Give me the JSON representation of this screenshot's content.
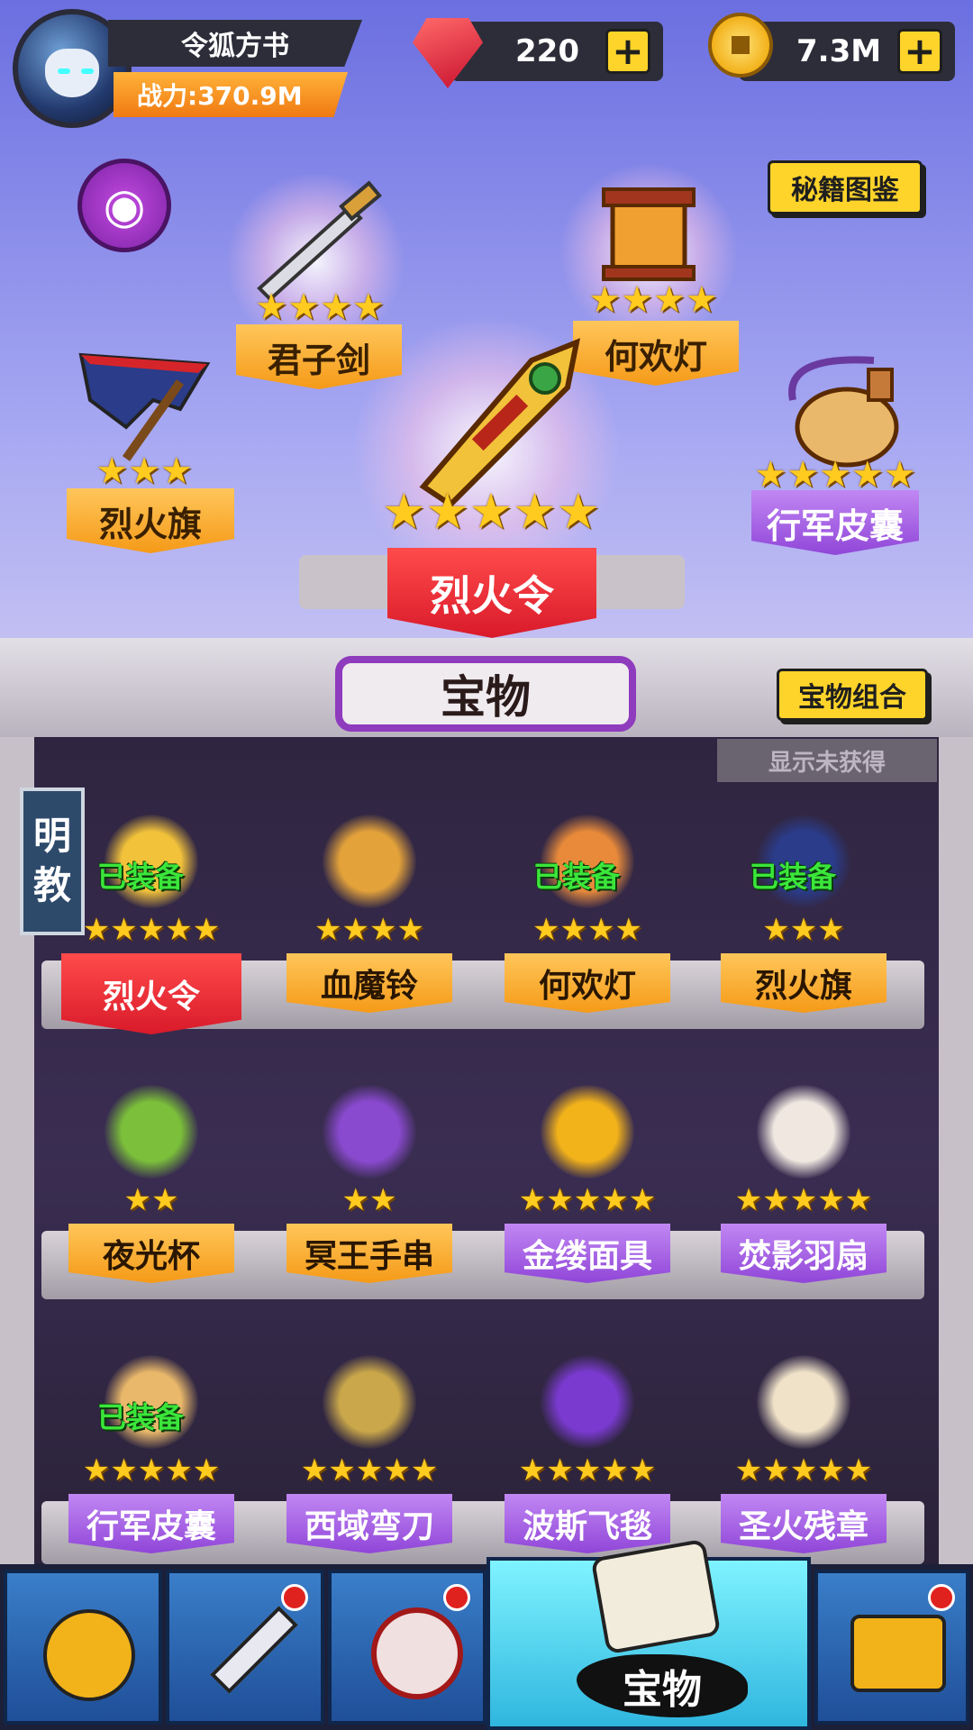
{
  "player": {
    "name": "令狐方书",
    "power": "战力:370.9M"
  },
  "currency": {
    "gems": "220",
    "coins": "7.3M",
    "plus": "+"
  },
  "buttons": {
    "codex": "秘籍图鉴",
    "combo": "宝物组合",
    "filter": "显示未获得"
  },
  "showcase": {
    "center": {
      "name": "烈火令",
      "stars": "★★★★★"
    },
    "top_left": {
      "name": "君子剑",
      "stars": "★★★★"
    },
    "top_right": {
      "name": "何欢灯",
      "stars": "★★★★"
    },
    "left": {
      "name": "烈火旗",
      "stars": "★★★"
    },
    "right": {
      "name": "行军皮囊",
      "stars": "★★★★★"
    }
  },
  "tab_title": "宝物",
  "faction": [
    "明",
    "教"
  ],
  "equipped_label": "已装备",
  "items": [
    {
      "name": "烈火令",
      "stars": "★★★★★",
      "equipped": true,
      "style": "red"
    },
    {
      "name": "血魔铃",
      "stars": "★★★★",
      "equipped": false,
      "style": "orange"
    },
    {
      "name": "何欢灯",
      "stars": "★★★★",
      "equipped": true,
      "style": "orange"
    },
    {
      "name": "烈火旗",
      "stars": "★★★",
      "equipped": true,
      "style": "orange"
    },
    {
      "name": "夜光杯",
      "stars": "★★",
      "equipped": false,
      "style": "orange"
    },
    {
      "name": "冥王手串",
      "stars": "★★",
      "equipped": false,
      "style": "orange"
    },
    {
      "name": "金缕面具",
      "stars": "★★★★★",
      "equipped": false,
      "style": "purple"
    },
    {
      "name": "焚影羽扇",
      "stars": "★★★★★",
      "equipped": false,
      "style": "purple"
    },
    {
      "name": "行军皮囊",
      "stars": "★★★★★",
      "equipped": true,
      "style": "purple"
    },
    {
      "name": "西域弯刀",
      "stars": "★★★★★",
      "equipped": false,
      "style": "purple"
    },
    {
      "name": "波斯飞毯",
      "stars": "★★★★★",
      "equipped": false,
      "style": "purple"
    },
    {
      "name": "圣火残章",
      "stars": "★★★★★",
      "equipped": false,
      "style": "purple"
    }
  ],
  "nav": {
    "active_label": "宝物"
  },
  "colors": {
    "orange": "#f59a18",
    "purple": "#9046d8",
    "red": "#d91a2a",
    "accent": "#ffd42a"
  }
}
